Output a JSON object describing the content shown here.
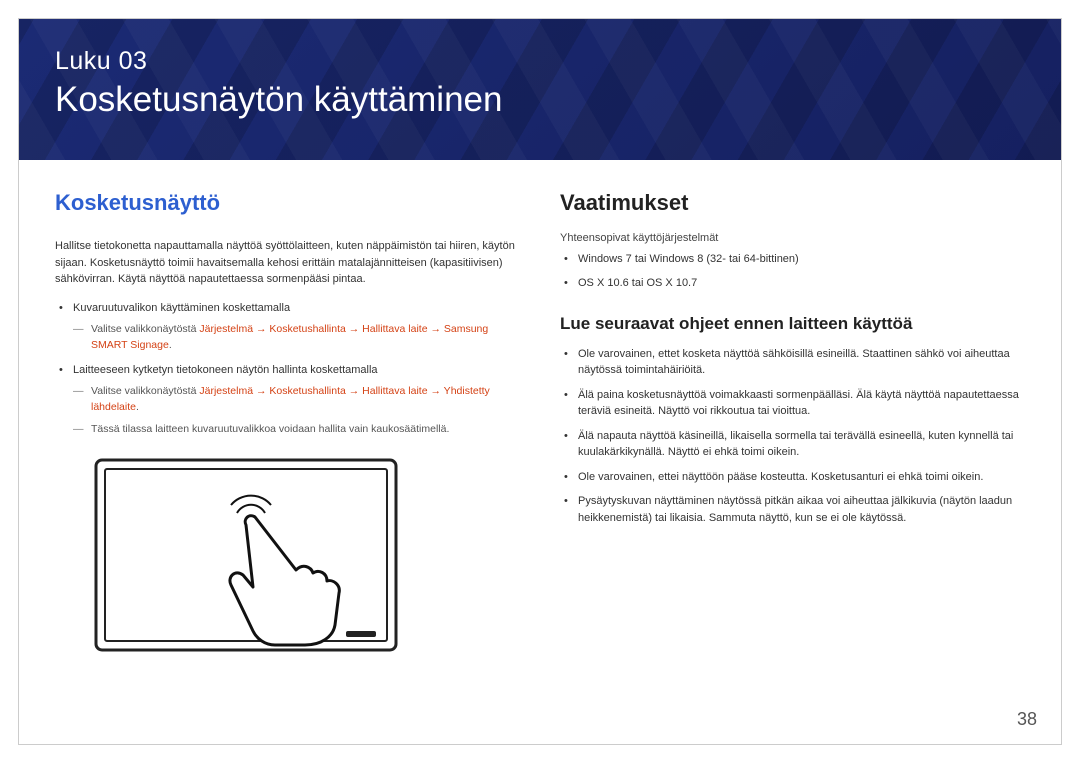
{
  "chapter": {
    "label": "Luku 03",
    "title": "Kosketusnäytön käyttäminen"
  },
  "left": {
    "heading": "Kosketusnäyttö",
    "intro": "Hallitse tietokonetta napauttamalla näyttöä syöttölaitteen, kuten näppäimistön tai hiiren, käytön sijaan. Kosketusnäyttö toimii havaitsemalla kehosi erittäin matalajännitteisen (kapasitiivisen) sähkövirran. Käytä näyttöä napautettaessa sormenpääsi pintaa.",
    "b1": "Kuvaruutuvalikon käyttäminen koskettamalla",
    "b1_sub_prefix": "Valitse valikkonäytöstä ",
    "b1_sub_red": "Järjestelmä → Kosketushallinta → Hallittava laite → Samsung SMART Signage",
    "b2": "Laitteeseen kytketyn tietokoneen näytön hallinta koskettamalla",
    "b2_sub1_prefix": "Valitse valikkonäytöstä ",
    "b2_sub1_red": "Järjestelmä → Kosketushallinta → Hallittava laite → Yhdistetty lähdelaite",
    "b2_sub2": "Tässä tilassa laitteen kuvaruutuvalikkoa voidaan hallita vain kaukosäätimellä."
  },
  "right": {
    "req_heading": "Vaatimukset",
    "req_label": "Yhteensopivat käyttöjärjestelmät",
    "req1": "Windows 7 tai Windows 8 (32- tai 64-bittinen)",
    "req2": "OS X 10.6 tai OS X 10.7",
    "read_heading": "Lue seuraavat ohjeet ennen laitteen käyttöä",
    "r1": "Ole varovainen, ettet kosketa näyttöä sähköisillä esineillä. Staattinen sähkö voi aiheuttaa näytössä toimintahäiriöitä.",
    "r2": "Älä paina kosketusnäyttöä voimakkaasti sormenpäälläsi. Älä käytä näyttöä napautettaessa teräviä esineitä. Näyttö voi rikkoutua tai vioittua.",
    "r3": "Älä napauta näyttöä käsineillä, likaisella sormella tai terävällä esineellä, kuten kynnellä tai kuulakärkikynällä. Näyttö ei ehkä toimi oikein.",
    "r4": "Ole varovainen, ettei näyttöön pääse kosteutta. Kosketusanturi ei ehkä toimi oikein.",
    "r5": "Pysäytyskuvan näyttäminen näytössä pitkän aikaa voi aiheuttaa jälkikuvia (näytön laadun heikkenemistä) tai likaisia. Sammuta näyttö, kun se ei ole käytössä."
  },
  "page_number": "38"
}
